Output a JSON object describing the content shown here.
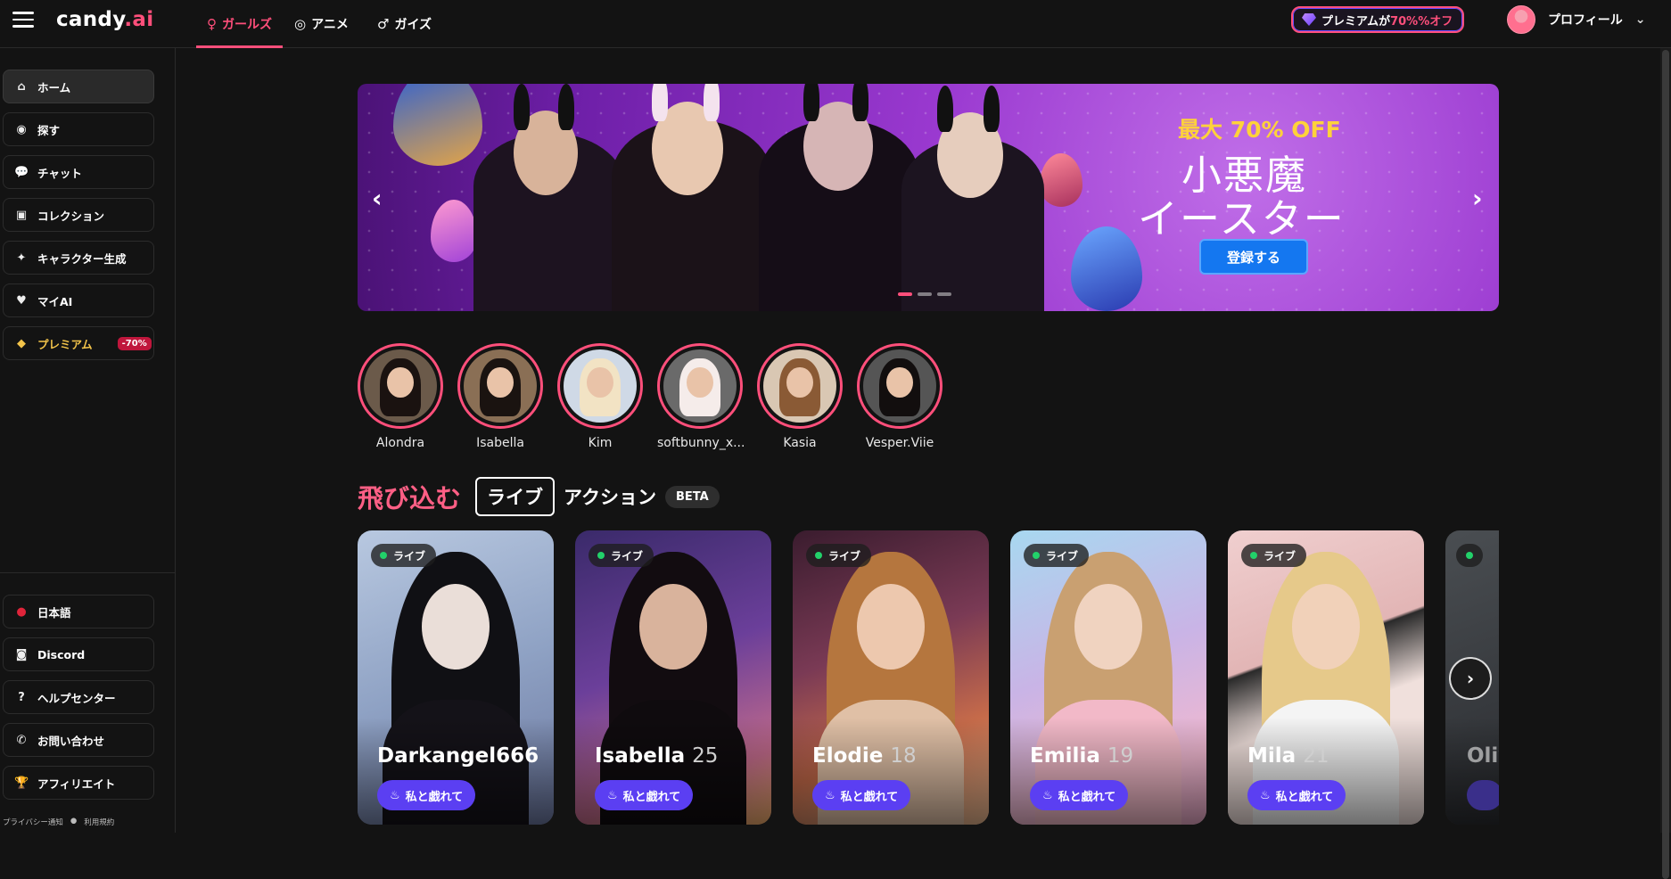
{
  "header": {
    "logo_main": "candy",
    "logo_dot": ".ai",
    "tabs": [
      {
        "label": "ガールズ",
        "icon": "♀"
      },
      {
        "label": "アニメ",
        "icon": "◎"
      },
      {
        "label": "ガイズ",
        "icon": "♂"
      }
    ],
    "premium": {
      "text": "プレミアムが",
      "highlight": "70%%オフ"
    },
    "profile_label": "プロフィール",
    "chevron": "⌄"
  },
  "sidebar": {
    "items": [
      {
        "label": "ホーム",
        "icon": "⌂"
      },
      {
        "label": "探す",
        "icon": "◉"
      },
      {
        "label": "チャット",
        "icon": "💬"
      },
      {
        "label": "コレクション",
        "icon": "▣"
      },
      {
        "label": "キャラクター生成",
        "icon": "✦"
      },
      {
        "label": "マイAI",
        "icon": "♥"
      },
      {
        "label": "プレミアム",
        "icon": "◆",
        "badge": "-70%"
      }
    ],
    "bottom": [
      {
        "label": "日本語",
        "icon": "●"
      },
      {
        "label": "Discord",
        "icon": "◙"
      },
      {
        "label": "ヘルプセンター",
        "icon": "?"
      },
      {
        "label": "お問い合わせ",
        "icon": "✆"
      },
      {
        "label": "アフィリエイト",
        "icon": "🏆"
      }
    ],
    "footer": [
      "プライバシー通知",
      "利用規約"
    ]
  },
  "banner": {
    "discount": "最大 70% OFF",
    "title_line1": "小悪魔",
    "title_line2": "イースター",
    "cta": "登録する",
    "prev": "‹",
    "next": "›"
  },
  "stories": [
    "Alondra",
    "Isabella",
    "Kim",
    "softbunny_x...",
    "Kasia",
    "Vesper.Viie"
  ],
  "section": {
    "title": "飛び込む",
    "live": "ライブ",
    "action": "アクション",
    "beta": "BETA"
  },
  "cards": [
    {
      "name": "Darkangel666",
      "age": "",
      "live": "ライブ",
      "button": "私と戯れて"
    },
    {
      "name": "Isabella",
      "age": "25",
      "live": "ライブ",
      "button": "私と戯れて"
    },
    {
      "name": "Elodie",
      "age": "18",
      "live": "ライブ",
      "button": "私と戯れて"
    },
    {
      "name": "Emilia",
      "age": "19",
      "live": "ライブ",
      "button": "私と戯れて"
    },
    {
      "name": "Mila",
      "age": "21",
      "live": "ライブ",
      "button": "私と戯れて"
    },
    {
      "name": "Oliv",
      "age": "",
      "live": "",
      "button": ""
    }
  ],
  "next_arrow": "›"
}
